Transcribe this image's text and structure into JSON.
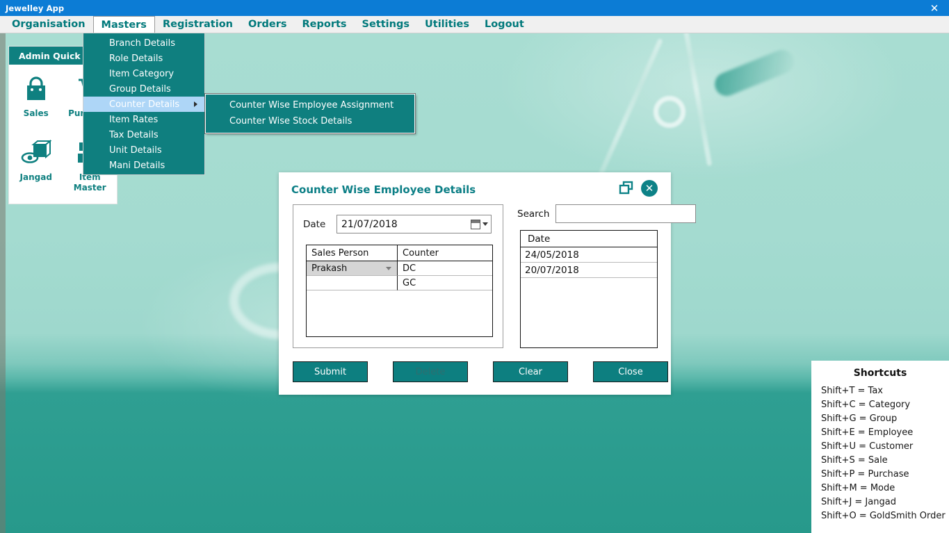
{
  "titlebar": {
    "title": "Jewelley App",
    "close_label": "✕"
  },
  "menubar": {
    "items": [
      {
        "label": "Organisation",
        "active": false
      },
      {
        "label": "Masters",
        "active": true
      },
      {
        "label": "Registration",
        "active": false
      },
      {
        "label": "Orders",
        "active": false
      },
      {
        "label": "Reports",
        "active": false
      },
      {
        "label": "Settings",
        "active": false
      },
      {
        "label": "Utilities",
        "active": false
      },
      {
        "label": "Logout",
        "active": false
      }
    ]
  },
  "dropdown": {
    "items": [
      {
        "label": "Branch Details"
      },
      {
        "label": "Role Details"
      },
      {
        "label": "Item Category"
      },
      {
        "label": "Group Details"
      },
      {
        "label": "Counter Details"
      },
      {
        "label": "Item Rates"
      },
      {
        "label": "Tax Details"
      },
      {
        "label": "Unit Details"
      },
      {
        "label": "Mani Details"
      }
    ],
    "highlighted": "Counter Details"
  },
  "submenu": {
    "items": [
      {
        "label": "Counter Wise Employee Assignment"
      },
      {
        "label": "Counter Wise Stock Details"
      }
    ]
  },
  "quick_panel": {
    "header": "Admin Quick",
    "tiles": [
      {
        "label": "Sales",
        "icon": "shopping-bag-icon"
      },
      {
        "label": "Purchase",
        "icon": "shopping-cart-icon"
      },
      {
        "label": "Jangad",
        "icon": "box-eye-icon"
      },
      {
        "label": "Item Master",
        "icon": "boxes-icon"
      }
    ]
  },
  "dialog": {
    "title": "Counter Wise Employee Details",
    "restore_icon": "restore-icon",
    "close_icon": "close-icon",
    "date_label": "Date",
    "date_value": "21/07/2018",
    "calendar_icon": "calendar-icon",
    "grid": {
      "headers": [
        "Sales Person",
        "Counter"
      ],
      "rows": [
        {
          "sales_person": "Prakash",
          "counter": "DC",
          "is_combo": true
        },
        {
          "sales_person": "",
          "counter": "GC",
          "is_combo": false
        }
      ]
    },
    "search_label": "Search",
    "search_value": "",
    "search_placeholder": "",
    "date_grid": {
      "header": "Date",
      "rows": [
        "24/05/2018",
        "20/07/2018"
      ]
    },
    "buttons": [
      {
        "label": "Submit",
        "dim": false
      },
      {
        "label": "Delete",
        "dim": true
      },
      {
        "label": "Clear",
        "dim": false
      },
      {
        "label": "Close",
        "dim": false
      }
    ]
  },
  "shortcuts": {
    "title": "Shortcuts",
    "items": [
      "Shift+T = Tax",
      "Shift+C = Category",
      "Shift+G = Group",
      "Shift+E = Employee",
      "Shift+U = Customer",
      "Shift+S = Sale",
      "Shift+P = Purchase",
      "Shift+M = Mode",
      "Shift+J = Jangad",
      "Shift+O = GoldSmith Order"
    ]
  },
  "colors": {
    "titlebar": "#0c7cd5",
    "teal": "#0f7f7f",
    "menu_text": "#00797b",
    "highlight": "#aed6f7",
    "dialog_title": "#0c7f86"
  }
}
